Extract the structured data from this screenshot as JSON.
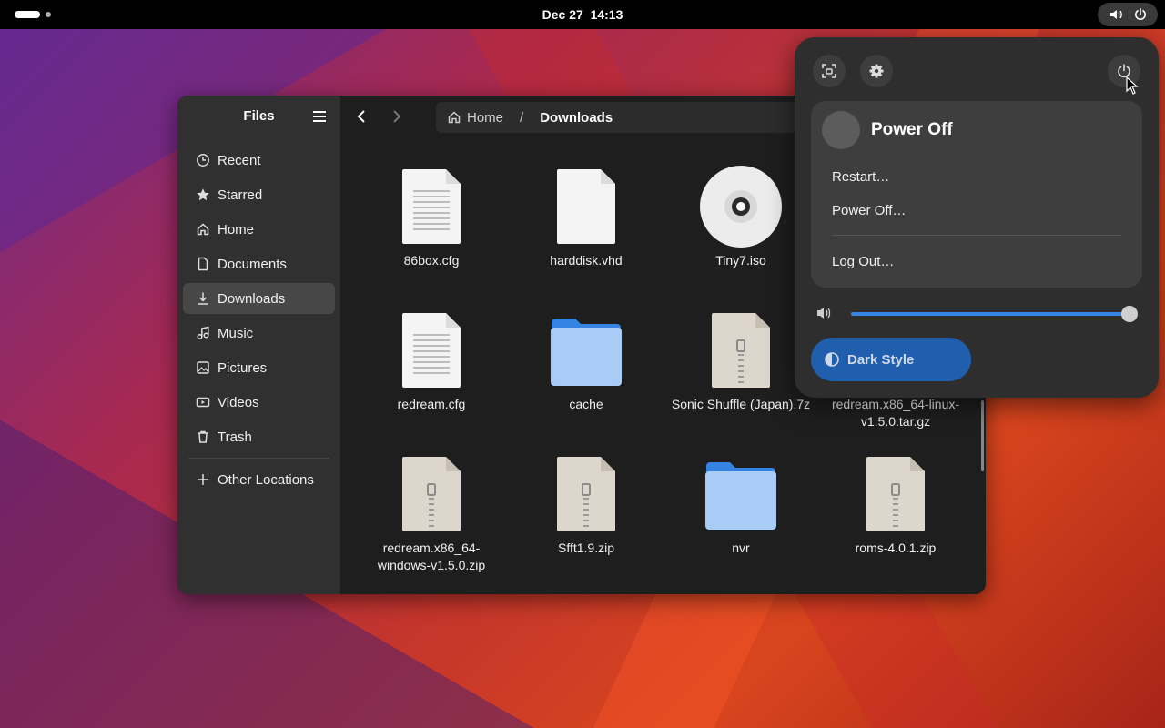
{
  "topbar": {
    "clock_date": "Dec 27",
    "clock_time": "14:13",
    "tray_icons": [
      "volume-icon",
      "power-icon"
    ]
  },
  "files": {
    "sidebar_title": "Files",
    "sidebar_items": [
      {
        "label": "Recent",
        "icon": "clock-icon"
      },
      {
        "label": "Starred",
        "icon": "star-icon"
      },
      {
        "label": "Home",
        "icon": "home-icon"
      },
      {
        "label": "Documents",
        "icon": "document-icon"
      },
      {
        "label": "Downloads",
        "icon": "download-icon",
        "active": true
      },
      {
        "label": "Music",
        "icon": "music-icon"
      },
      {
        "label": "Pictures",
        "icon": "picture-icon"
      },
      {
        "label": "Videos",
        "icon": "video-icon"
      },
      {
        "label": "Trash",
        "icon": "trash-icon"
      }
    ],
    "other_locations": "Other Locations",
    "path": {
      "home": "Home",
      "current": "Downloads"
    },
    "items": [
      {
        "name": "86box.cfg",
        "type": "text"
      },
      {
        "name": "harddisk.vhd",
        "type": "blank"
      },
      {
        "name": "Tiny7.iso",
        "type": "disc"
      },
      {
        "name": "redream.cfg",
        "type": "text"
      },
      {
        "name": "cache",
        "type": "folder"
      },
      {
        "name": "Sonic Shuffle (Japan).7z",
        "type": "archive"
      },
      {
        "name": "redream.x86_64-linux-v1.5.0.tar.gz",
        "type": "archive"
      },
      {
        "name": "redream.x86_64-windows-v1.5.0.zip",
        "type": "archive"
      },
      {
        "name": "Sfft1.9.zip",
        "type": "archive"
      },
      {
        "name": "nvr",
        "type": "folder"
      },
      {
        "name": "roms-4.0.1.zip",
        "type": "archive"
      }
    ]
  },
  "quick_settings": {
    "top_buttons": [
      "screenshot-icon",
      "settings-icon",
      "power-icon"
    ],
    "power_menu": {
      "title": "Power Off",
      "restart": "Restart…",
      "power_off": "Power Off…",
      "log_out": "Log Out…"
    },
    "volume_level": 1.0,
    "dark_style_label": "Dark Style"
  },
  "colors": {
    "accent": "#3584e4",
    "dark_style_bg": "#1f5fae",
    "window_bg": "#1e1e1e",
    "sidebar_bg": "#303030"
  }
}
